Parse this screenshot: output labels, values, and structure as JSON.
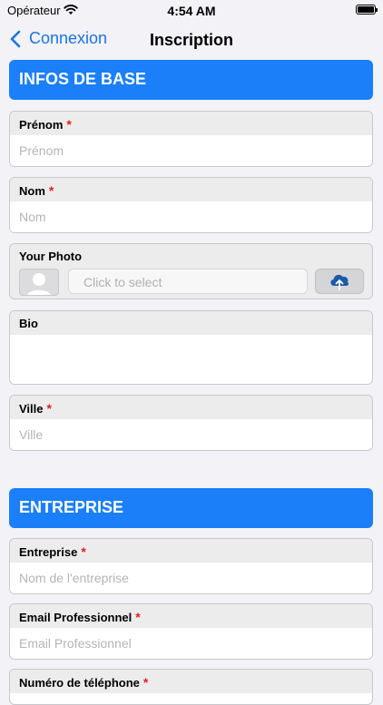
{
  "status_bar": {
    "carrier": "Opérateur",
    "time": "4:54 AM"
  },
  "nav": {
    "back_label": "Connexion",
    "title": "Inscription"
  },
  "sections": {
    "basic": {
      "title": "INFOS DE BASE"
    },
    "company": {
      "title": "ENTREPRISE"
    }
  },
  "fields": {
    "prenom": {
      "label": "Prénom",
      "placeholder": "Prénom",
      "required_mark": "*"
    },
    "nom": {
      "label": "Nom",
      "placeholder": "Nom",
      "required_mark": "*"
    },
    "photo": {
      "label": "Your Photo",
      "select_text": "Click to select"
    },
    "bio": {
      "label": "Bio"
    },
    "ville": {
      "label": "Ville",
      "placeholder": "Ville",
      "required_mark": "*"
    },
    "entreprise": {
      "label": "Entreprise",
      "placeholder": "Nom de l'entreprise",
      "required_mark": "*"
    },
    "email_pro": {
      "label": "Email Professionnel",
      "placeholder": "Email Professionnel",
      "required_mark": "*"
    },
    "telephone": {
      "label": "Numéro de téléphone",
      "required_mark": "*"
    }
  },
  "colors": {
    "accent": "#1a7ff8",
    "link": "#1a73e8",
    "required": "#e02020"
  },
  "icons": {
    "back": "chevron-left-icon",
    "upload": "cloud-upload-icon",
    "avatar": "person-placeholder-icon",
    "wifi": "wifi-icon",
    "battery": "battery-icon"
  }
}
